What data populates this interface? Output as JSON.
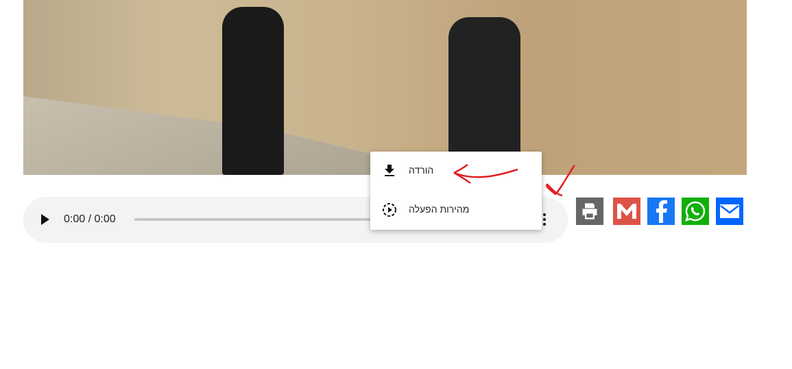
{
  "audio": {
    "time": "0:00 / 0:00"
  },
  "menu": {
    "items": [
      {
        "label": "הורדה",
        "icon": "download-icon"
      },
      {
        "label": "מהירות הפעלה",
        "icon": "playback-speed-icon"
      }
    ]
  },
  "share": [
    {
      "name": "print",
      "color": "#666666"
    },
    {
      "name": "gmail",
      "color": "#dd5347"
    },
    {
      "name": "facebook",
      "color": "#1877f2"
    },
    {
      "name": "whatsapp",
      "color": "#12af0a"
    },
    {
      "name": "email",
      "color": "#0166ff"
    }
  ],
  "annotation_color": "#e02020"
}
